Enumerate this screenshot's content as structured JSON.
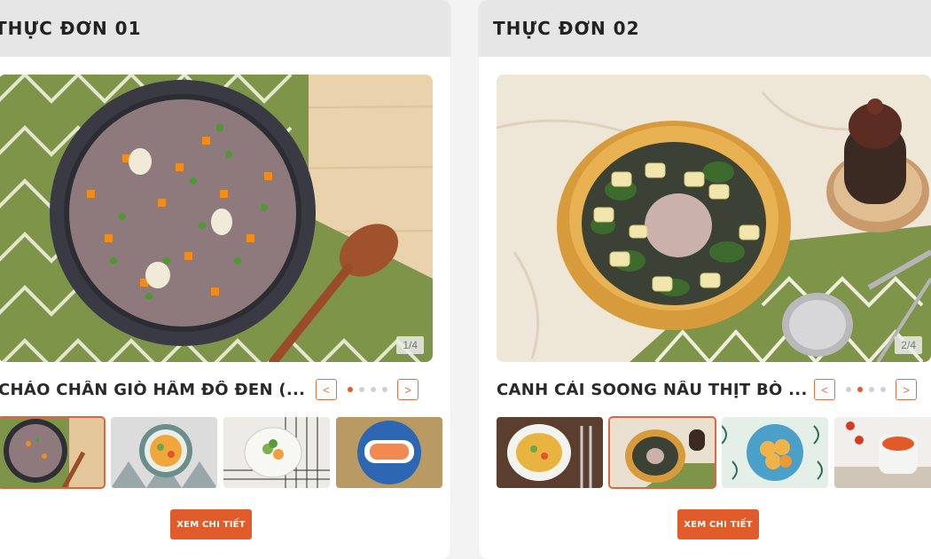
{
  "menus": [
    {
      "title": "THỰC ĐƠN 01",
      "dish_name": "CHÁO CHÂN GIÒ HẦM ĐỖ ĐEN (...",
      "counter": "1/4",
      "prev_label": "<",
      "next_label": ">",
      "dots_active": 1,
      "cta_label": "XEM CHI TIẾT",
      "photo_icon": "porridge-bowl-photo"
    },
    {
      "title": "THỰC ĐƠN 02",
      "dish_name": "CANH CẢI SOONG NẤU THỊT BÒ ...",
      "counter": "2/4",
      "prev_label": "<",
      "next_label": ">",
      "dots_active": 2,
      "cta_label": "XEM CHI TIẾT",
      "photo_icon": "soup-bowl-photo"
    }
  ],
  "colors": {
    "accent": "#e15c2b",
    "header_bg": "#e6e6e6"
  }
}
